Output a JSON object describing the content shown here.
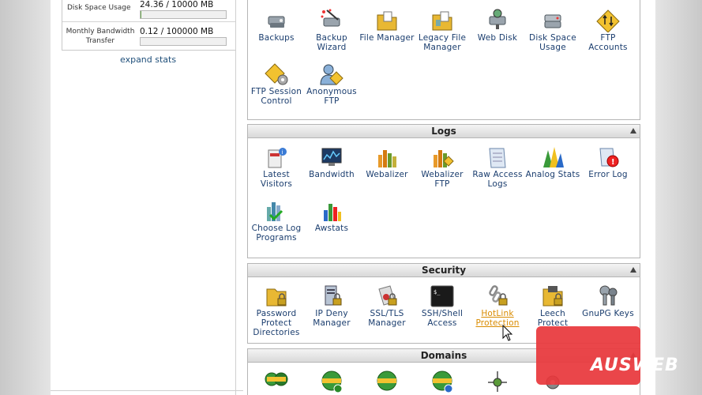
{
  "sidebar": {
    "stats": [
      {
        "label": "Disk Space Usage",
        "value": "24.36 / 10000 MB",
        "fraction": 0.0024
      },
      {
        "label": "Monthly Bandwidth Transfer",
        "value": "0.12 / 100000 MB",
        "fraction": 1.2e-06
      }
    ],
    "expand_label": "expand stats"
  },
  "files": {
    "items": [
      {
        "label": "Backups",
        "icon": "backups-icon"
      },
      {
        "label": "Backup Wizard",
        "icon": "backup-wizard-icon"
      },
      {
        "label": "File Manager",
        "icon": "file-manager-icon"
      },
      {
        "label": "Legacy File Manager",
        "icon": "legacy-file-manager-icon"
      },
      {
        "label": "Web Disk",
        "icon": "web-disk-icon"
      },
      {
        "label": "Disk Space Usage",
        "icon": "disk-space-icon"
      },
      {
        "label": "FTP Accounts",
        "icon": "ftp-accounts-icon"
      },
      {
        "label": "FTP Session Control",
        "icon": "ftp-session-icon"
      },
      {
        "label": "Anonymous FTP",
        "icon": "anonymous-ftp-icon"
      }
    ]
  },
  "logs": {
    "title": "Logs",
    "items": [
      {
        "label": "Latest Visitors",
        "icon": "latest-visitors-icon"
      },
      {
        "label": "Bandwidth",
        "icon": "bandwidth-icon"
      },
      {
        "label": "Webalizer",
        "icon": "webalizer-icon"
      },
      {
        "label": "Webalizer FTP",
        "icon": "webalizer-ftp-icon"
      },
      {
        "label": "Raw Access Logs",
        "icon": "raw-access-logs-icon"
      },
      {
        "label": "Analog Stats",
        "icon": "analog-stats-icon"
      },
      {
        "label": "Error Log",
        "icon": "error-log-icon"
      },
      {
        "label": "Choose Log Programs",
        "icon": "choose-log-programs-icon"
      },
      {
        "label": "Awstats",
        "icon": "awstats-icon"
      }
    ]
  },
  "security": {
    "title": "Security",
    "items": [
      {
        "label": "Password Protect Directories",
        "icon": "folder-lock-icon"
      },
      {
        "label": "IP Deny Manager",
        "icon": "ip-deny-icon"
      },
      {
        "label": "SSL/TLS Manager",
        "icon": "ssl-certificate-icon"
      },
      {
        "label": "SSH/Shell Access",
        "icon": "terminal-icon"
      },
      {
        "label": "HotLink Protection",
        "icon": "chain-lock-icon"
      },
      {
        "label": "Leech Protect",
        "icon": "leech-protect-icon"
      },
      {
        "label": "GnuPG Keys",
        "icon": "keys-icon"
      }
    ]
  },
  "domains": {
    "title": "Domains"
  },
  "overlay": {
    "logo_text": "AUSWEB"
  },
  "colors": {
    "link": "#1a3d6e",
    "hover_link": "#d98b00",
    "logo_red": "#e8383c"
  }
}
